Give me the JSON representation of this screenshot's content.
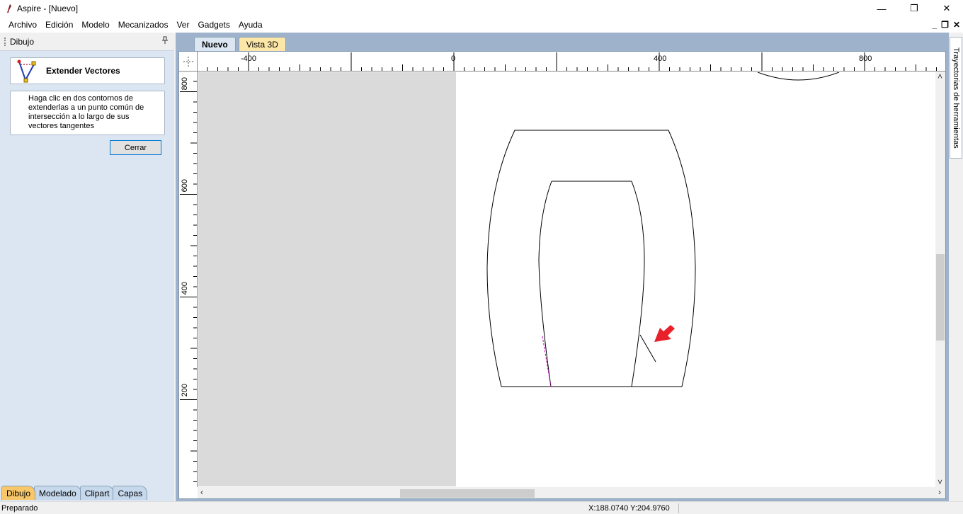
{
  "window": {
    "title": "Aspire - [Nuevo]",
    "minimize": "—",
    "restore": "❐",
    "close": "✕"
  },
  "menu": [
    "Archivo",
    "Edición",
    "Modelo",
    "Mecanizados",
    "Ver",
    "Gadgets",
    "Ayuda"
  ],
  "mdi_controls": {
    "minimize": "_",
    "restore": "❐",
    "close": "✕"
  },
  "left_panel": {
    "header": "Dibujo",
    "pin": "📌",
    "tool_name": "Extender Vectores",
    "help_text": "Haga clic en dos contornos de extenderlas a un punto común de intersección a lo largo de sus vectores tangentes",
    "close_label": "Cerrar",
    "tabs": [
      "Dibujo",
      "Modelado",
      "Clipart",
      "Capas"
    ],
    "active_tab": "Dibujo"
  },
  "doc_tabs": [
    "Nuevo",
    "Vista 3D"
  ],
  "active_doc_tab": "Nuevo",
  "rulers": {
    "h_labels": [
      "-400",
      "0",
      "400",
      "800"
    ],
    "v_labels": [
      "800",
      "600",
      "400",
      "200"
    ]
  },
  "right_panel": {
    "tab": "Trayectorias de herramientas"
  },
  "status": {
    "text": "Preparado",
    "coords": "X:188.0740 Y:204.9760"
  },
  "colors": {
    "panel": "#dbe6f2",
    "active_tab": "#f7c76a",
    "accent": "#0078d7",
    "arrow": "#e8202a",
    "extension": "#c000c0"
  }
}
